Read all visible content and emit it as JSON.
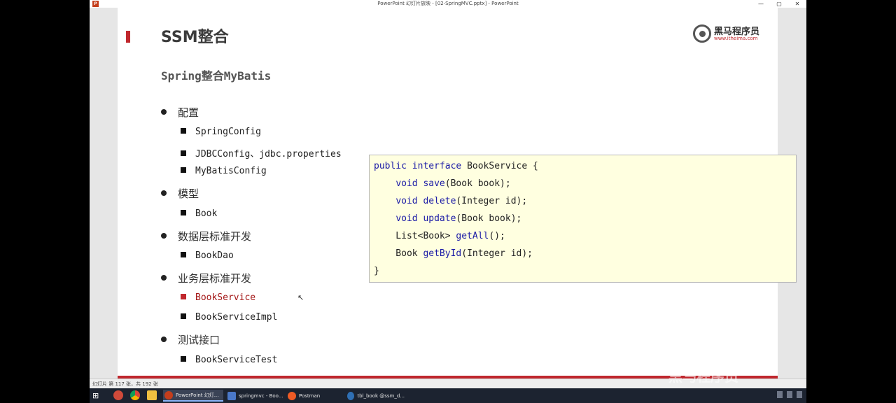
{
  "window": {
    "title": "PowerPoint 幻灯片放映 - [02-SpringMVC.pptx] - PowerPoint",
    "app_icon": "P",
    "controls": [
      "—",
      "▢",
      "✕"
    ]
  },
  "slide": {
    "title": "SSM整合",
    "subtitle": "Spring整合MyBatis",
    "logo": {
      "name": "黑马程序员",
      "url": "www.itheima.com"
    },
    "sections": [
      {
        "label": "配置",
        "items": [
          "SpringConfig",
          "JDBCConfig、jdbc.properties",
          "MyBatisConfig"
        ]
      },
      {
        "label": "模型",
        "items": [
          "Book"
        ]
      },
      {
        "label": "数据层标准开发",
        "items": [
          "BookDao"
        ]
      },
      {
        "label": "业务层标准开发",
        "items": [
          "BookService",
          "BookServiceImpl"
        ]
      },
      {
        "label": "测试接口",
        "items": [
          "BookServiceTest"
        ]
      }
    ],
    "active_item": "BookService",
    "code": {
      "l1": [
        "public",
        " ",
        "interface",
        " BookService {"
      ],
      "l2": [
        "    ",
        "void",
        " ",
        "save",
        "(Book book);"
      ],
      "l3": [
        "    ",
        "void",
        " ",
        "delete",
        "(Integer id);"
      ],
      "l4": [
        "    ",
        "void",
        " ",
        "update",
        "(Book book);"
      ],
      "l5": [
        "    List<Book> ",
        "getAll",
        "();"
      ],
      "l6": [
        "    Book ",
        "getById",
        "(Integer id);"
      ],
      "l7": "}"
    }
  },
  "statusbar": {
    "text": "幻灯片 第 117 张，共 192 张"
  },
  "taskbar": {
    "apps": [
      {
        "label": "PowerPoint 幻灯...",
        "color": "#c43e1c"
      },
      {
        "label": "springmvc - Boo...",
        "color": "#4a78c8"
      },
      {
        "label": "Postman",
        "color": "#ef5b25"
      },
      {
        "label": "tbl_book @ssm_d...",
        "color": "#2f6fb3"
      }
    ]
  },
  "watermark": "黑马程序员"
}
